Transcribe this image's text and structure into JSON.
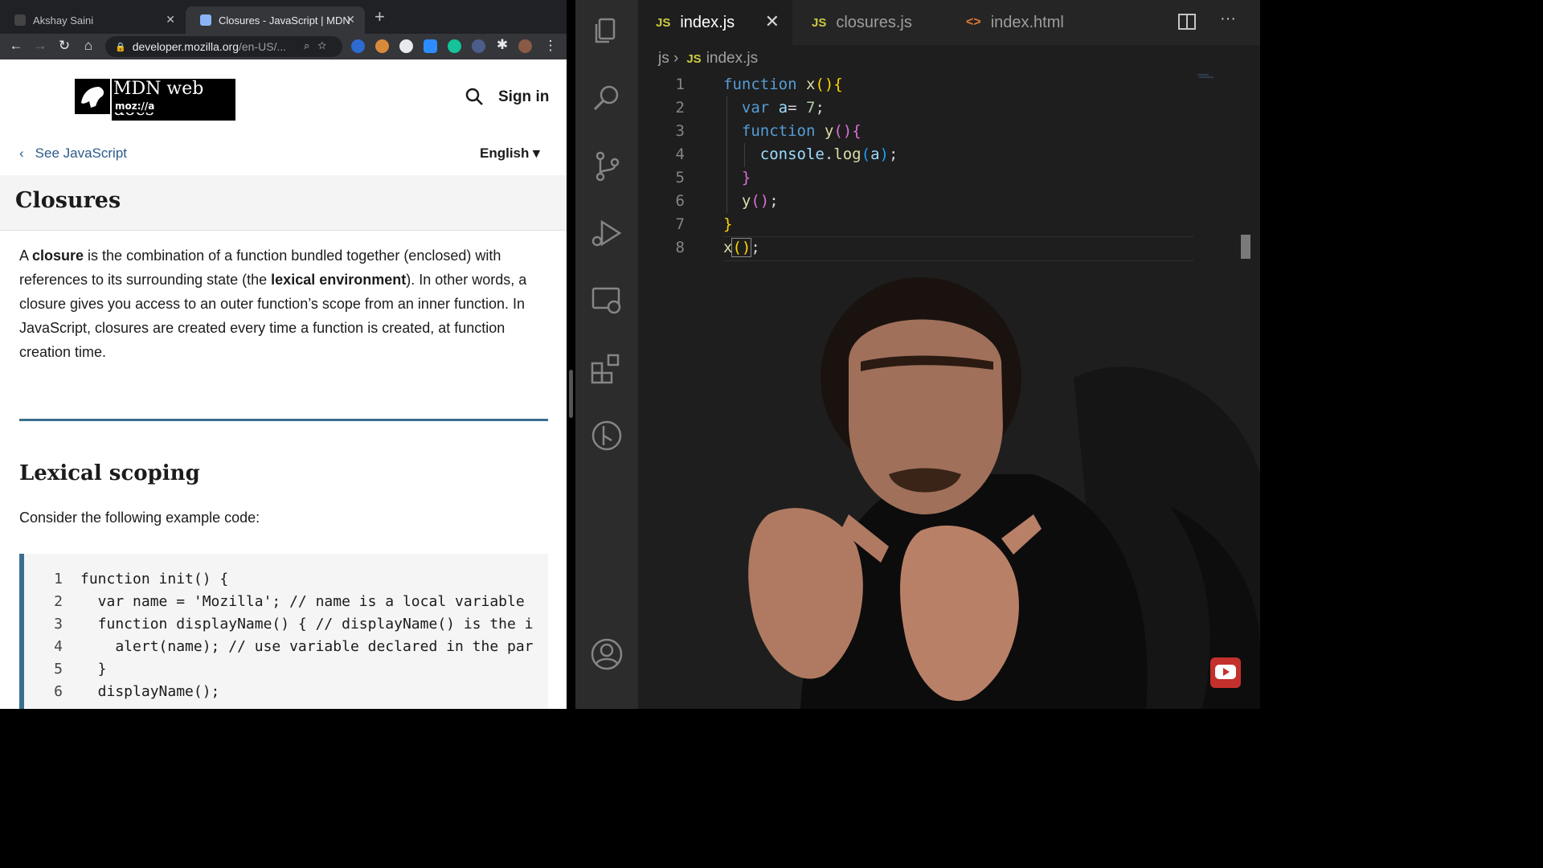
{
  "browser": {
    "tabs": [
      {
        "title": "Akshay Saini",
        "active": false
      },
      {
        "title": "Closures - JavaScript | MDN",
        "active": true
      }
    ],
    "url_host": "developer.mozilla.org",
    "url_path": "/en-US/..."
  },
  "mdn": {
    "logo_top": "MDN web docs",
    "logo_bottom": "moz://a",
    "sign_in": "Sign in",
    "back_link": "See JavaScript",
    "language": "English ▾",
    "page_title": "Closures",
    "intro": {
      "p1": "A ",
      "b1": "closure",
      "p2": " is the combination of a function bundled together (enclosed) with references to its surrounding state (the ",
      "b2": "lexical environment",
      "p3": "). In other words, a closure gives you access to an outer function’s scope from an inner function. In JavaScript, closures are created every time a function is created, at function creation time."
    },
    "section_heading": "Lexical scoping",
    "consider_text": "Consider the following example code:",
    "code_lines": [
      "function init() {",
      "  var name = 'Mozilla'; // name is a local variable",
      "  function displayName() { // displayName() is the i",
      "    alert(name); // use variable declared in the par",
      "  }",
      "  displayName();"
    ]
  },
  "editor": {
    "tabs": [
      {
        "badge": "JS",
        "name": "index.js",
        "active": true
      },
      {
        "badge": "JS",
        "name": "closures.js",
        "active": false
      },
      {
        "badge": "<>",
        "name": "index.html",
        "active": false
      }
    ],
    "breadcrumb_folder": "js",
    "breadcrumb_badge": "JS",
    "breadcrumb_file": "index.js",
    "lines": [
      "function x(){",
      "  var a= 7;",
      "  function y(){",
      "    console.log(a);",
      "  }",
      "  y();",
      "}",
      "x();"
    ]
  },
  "colors": {
    "vscode_bg": "#1e1e1e",
    "keyword": "#569cd6",
    "function": "#dcdcaa",
    "mdn_accent": "#3b6e8f"
  }
}
